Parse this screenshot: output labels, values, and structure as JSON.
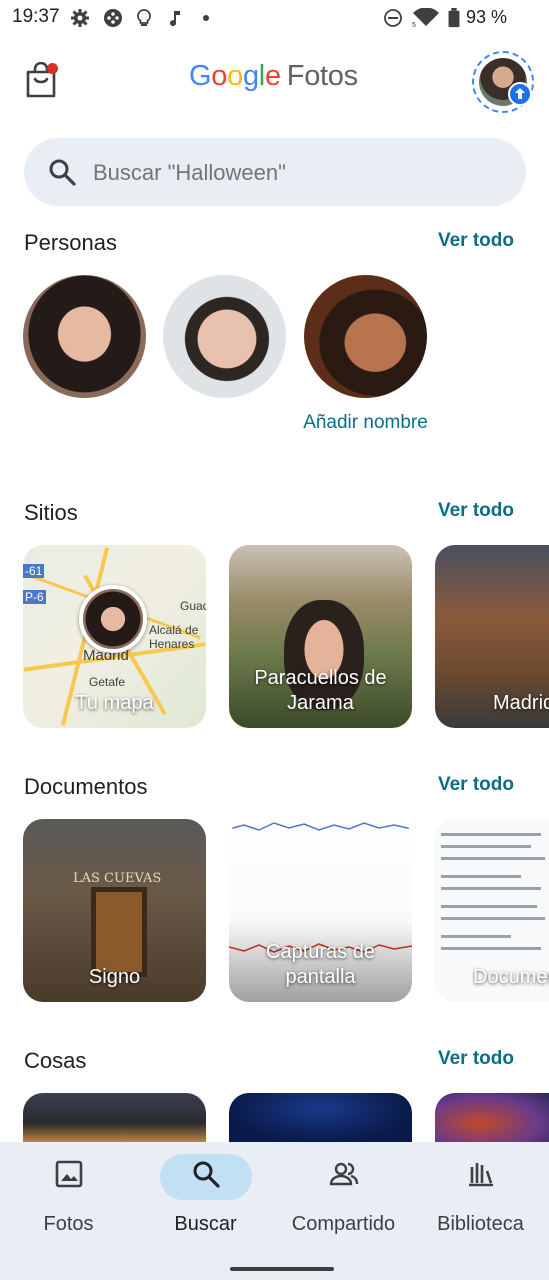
{
  "status_bar": {
    "time": "19:37",
    "battery": "93 %"
  },
  "header": {
    "logo_google": "Google",
    "logo_fotos": "Fotos"
  },
  "search": {
    "placeholder": "Buscar \"Halloween\""
  },
  "sections": {
    "personas": {
      "title": "Personas",
      "link": "Ver todo",
      "add_name": "Añadir nombre"
    },
    "sitios": {
      "title": "Sitios",
      "link": "Ver todo",
      "cards": [
        "Tu mapa",
        "Paracuellos de Jarama",
        "Madrid"
      ],
      "map_labels": [
        "Madrid",
        "Getafe",
        "Alcalá de Henares",
        "Guad",
        "-61",
        "P-6"
      ]
    },
    "documentos": {
      "title": "Documentos",
      "link": "Ver todo",
      "cards": [
        "Signo",
        "Capturas de pantalla",
        "Documentos"
      ],
      "signo_sign": "LAS CUEVAS"
    },
    "cosas": {
      "title": "Cosas",
      "link": "Ver todo"
    }
  },
  "bottom_nav": [
    {
      "label": "Fotos",
      "icon": "photo-icon",
      "active": false
    },
    {
      "label": "Buscar",
      "icon": "search-icon",
      "active": true
    },
    {
      "label": "Compartido",
      "icon": "people-icon",
      "active": false
    },
    {
      "label": "Biblioteca",
      "icon": "library-icon",
      "active": false
    }
  ],
  "colors": {
    "accent": "#0b6e87",
    "search_bg": "#e8eef3",
    "nav_active": "#c2e0f3"
  }
}
